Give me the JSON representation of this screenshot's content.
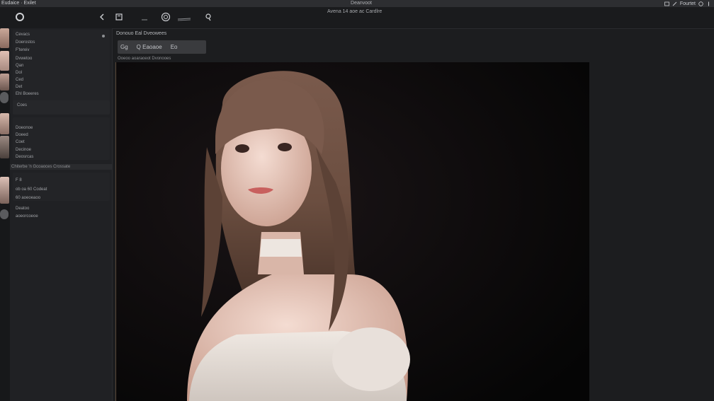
{
  "window": {
    "menu_left": "Eudaice · Exilet",
    "center_title": "Deanvoot",
    "right_label": "Fourtet"
  },
  "toolbar": {
    "title": "Avena 14 aoe ac Cardlre",
    "icons": [
      "logo-icon",
      "back-icon",
      "save-icon",
      "brush-icon",
      "layer-icon",
      "pen-icon"
    ]
  },
  "leftpanel": {
    "group1": [
      "Cevacs",
      "Doerostos",
      "F'tereiv",
      "Dvwetoo",
      "Qan",
      "Dol",
      "Ced",
      "Det",
      "Ehl Boeeres"
    ],
    "group1_extra": "Coes",
    "group2": [
      "Doeonoe",
      "Doeed",
      "Coet",
      "Decinoe",
      "Deosrcas"
    ],
    "section_header": "Chiterbe 'n Gcoaoces Crossate",
    "group3": [
      "F 8",
      "ob oa 60 Codeat",
      "60 aoeoeaoo",
      "Deatoo",
      "aoeorcoeoe"
    ]
  },
  "workspace": {
    "breadcrumb": "Donouo Eal Dveowees",
    "tabs": [
      "Gg",
      "Q Eaoaoe",
      "Eo"
    ],
    "canvas_label": "Ooeoo aoaraoeot Dvonooes"
  },
  "colors": {
    "background": "#1c1d1f",
    "panel": "#202124",
    "canvas": "#0b0b0c",
    "hair": "#6b4e40"
  }
}
